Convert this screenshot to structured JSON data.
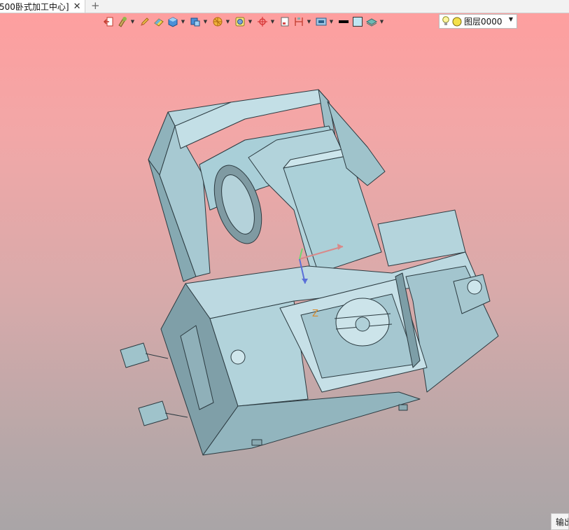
{
  "document_tab": {
    "label": "500卧式加工中心]",
    "close_icon": "close-icon",
    "add_icon": "plus-icon"
  },
  "toolbar": {
    "icons": [
      "exit-icon",
      "paint-brush-icon",
      "pencil-icon",
      "eraser-icon",
      "shaded-cube-icon",
      "cube-views-icon",
      "section-icon",
      "render-icon",
      "crosshair-icon",
      "frame-icon",
      "dimension-icon",
      "viewport-icon",
      "line-color-swatch",
      "fill-color-swatch",
      "layers-icon"
    ],
    "layer": {
      "bulb_icon": "lightbulb-icon",
      "color_icon": "yellow-dot-icon",
      "name": "图层0000"
    }
  },
  "viewport": {
    "model": "horizontal-machining-center",
    "background_top": "#ff9e9e",
    "background_bottom": "#a9a5a7",
    "part_color": "#a9cfd8",
    "axis_label": "Z"
  },
  "output_panel": {
    "label": "输出"
  }
}
